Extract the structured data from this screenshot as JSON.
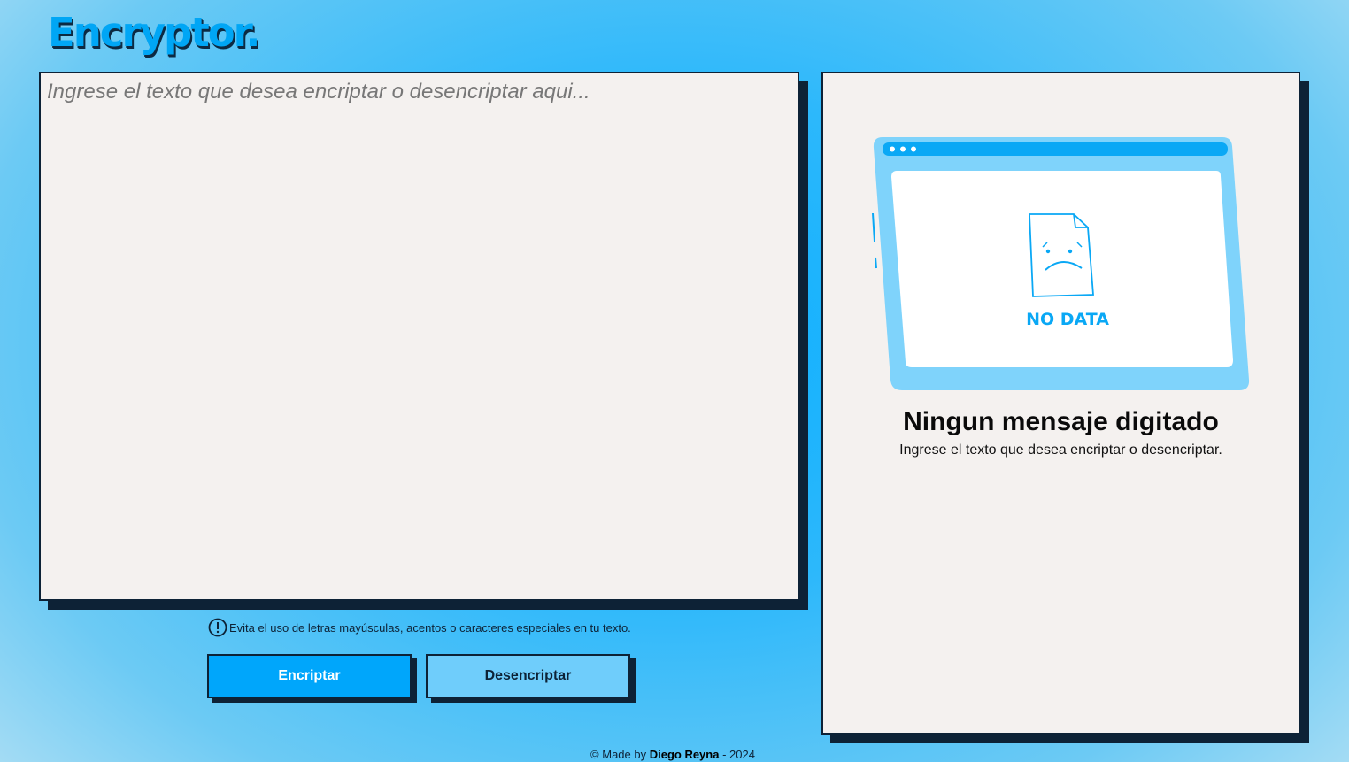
{
  "header": {
    "logo": "Encryptor."
  },
  "input": {
    "placeholder": "Ingrese el texto que desea encriptar o desencriptar aqui..."
  },
  "warning": {
    "icon": "exclamation-circle-icon",
    "text": "Evita el uso de letras mayúsculas, acentos o caracteres especiales en tu texto."
  },
  "buttons": {
    "encrypt": "Encriptar",
    "decrypt": "Desencriptar"
  },
  "output": {
    "illustration_label": "NO DATA",
    "title": "Ningun mensaje digitado",
    "subtitle": "Ingrese el texto que desea encriptar o desencriptar."
  },
  "footer": {
    "prefix": "© Made by ",
    "author": "Diego Reyna",
    "suffix": " - 2024"
  },
  "colors": {
    "accent": "#00a6fb",
    "accent_light": "#6fcdfb",
    "dark": "#0d2236",
    "panel": "#f4f1ef"
  }
}
